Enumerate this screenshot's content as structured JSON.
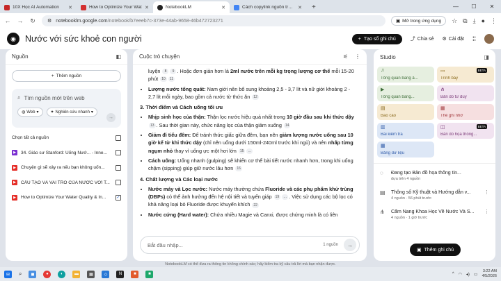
{
  "tabs": [
    {
      "title": "10X Học AI Automation",
      "color": "#c62828"
    },
    {
      "title": "How to Optimize Your Wat",
      "color": "#d32f2f"
    },
    {
      "title": "NotebookLM",
      "color": "#222"
    },
    {
      "title": "Cách copylink nguồn trong not",
      "color": "#4285f4"
    }
  ],
  "address": {
    "domain": "notebooklm.google.com",
    "path": "/notebook/b7eeeb7c-373e-44ab-9658-46b472723271",
    "open_in_app": "Mở trong ứng dụng"
  },
  "app": {
    "title": "Nước với sức khoẻ con người",
    "create_note": "Tạo sổ ghi chú",
    "share": "Chia sẻ",
    "settings": "Cài đặt"
  },
  "sources": {
    "header": "Nguồn",
    "add": "Thêm nguồn",
    "search_placeholder": "Tìm nguồn mới trên web",
    "chip_web": "Web",
    "chip_research": "Nghiên cứu nhanh",
    "select_all": "Chọn tất cả nguồn",
    "items": [
      {
        "title": "34. Giáo sư Stanford: Uống Nướ... - Inne...",
        "icon": "youtube",
        "checked": false
      },
      {
        "title": "Chuyện gì sẽ xảy ra nếu bạn không uốn...",
        "icon": "youtube",
        "checked": false
      },
      {
        "title": "CẤU TẠO VÀ VAI TRÒ CỦA NƯỚC VỚI T...",
        "icon": "youtube",
        "checked": false
      },
      {
        "title": "How to Optimize Your Water Quality & In...",
        "icon": "youtube",
        "checked": true
      }
    ]
  },
  "chat": {
    "header": "Cuộc trò chuyện",
    "l1a": "luyện",
    "l1b": ". Hoặc đơn giản hơn là",
    "l1c": "2ml nước trên mỗi kg trọng lượng cơ thể",
    "l1d": "mỗi 15-20 phút",
    "l2a": "Lượng nước tổng quát:",
    "l2b": "Nam giới nên bổ sung khoảng 2,5 - 3,7 lít và nữ giới khoảng 2 - 2,7 lít mỗi ngày, bao gồm cả nước từ thức ăn",
    "h3": "3. Thời điểm và Cách uống tối ưu",
    "m1a": "Nhịp sinh học của thận:",
    "m1b": "Thận lọc nước hiệu quả nhất trong",
    "m1c": "10 giờ đầu sau khi thức dậy",
    "m1d": ". Sau thời gian này, chức năng lọc của thận giảm xuống",
    "m2a": "Giảm đi tiểu đêm:",
    "m2b": "Để tránh thức giấc giữa đêm, bạn nên",
    "m2c": "giảm lượng nước uống sau 10 giờ kể từ khi thức dậy",
    "m2d": "(chỉ nên uống dưới 150ml-240ml trước khi ngủ) và nên",
    "m2e": "nhấp từng ngụm nhỏ",
    "m2f": "thay vì uống ực một hơi lớn",
    "m3a": "Cách uống:",
    "m3b": "Uống nhanh (gulping) sẽ khiến cơ thể bài tiết nước nhanh hơn, trong khi uống chậm (sipping) giúp giữ nước lâu hơn",
    "h4": "4. Chất lượng và Các loại nước",
    "q1a": "Nước máy và Lọc nước:",
    "q1b": "Nước máy thường chứa",
    "q1c": "Fluoride và các phụ phẩm khử trùng (DBPs)",
    "q1d": "có thể ảnh hưởng đến hệ nội tiết và tuyến giáp",
    "q1e": ". Việc sử dụng các bộ lọc có khả năng loại bỏ Fluoride được khuyến khích",
    "q2a": "Nước cứng (Hard water):",
    "q2b": "Chứa nhiều Magie và Canxi, được chứng minh là có liên",
    "c": {
      "a": "8",
      "b": "9",
      "c": "10",
      "d": "11",
      "e": "12",
      "f": "13",
      "g": "14",
      "h": "15",
      "i": "…",
      "j": "16",
      "k": "19",
      "l": "…",
      "m": "22"
    },
    "input_placeholder": "Bắt đầu nhập...",
    "source_count": "1 nguồn"
  },
  "studio": {
    "header": "Studio",
    "cards": [
      {
        "label": "Tổng quan bằng â...",
        "icon": "audio-icon",
        "bg": "#e6efe0",
        "fg": "#3f6f3a"
      },
      {
        "label": "Trình bày",
        "icon": "slides-icon",
        "bg": "#f6ead2",
        "fg": "#8a6a1c",
        "beta": "BETA"
      },
      {
        "label": "Tổng quan bằng...",
        "icon": "video-icon",
        "bg": "#e6efe0",
        "fg": "#3f6f3a"
      },
      {
        "label": "Bản đồ tư duy",
        "icon": "mindmap-icon",
        "bg": "#f1e3f0",
        "fg": "#7b3b78"
      },
      {
        "label": "Báo cáo",
        "icon": "report-icon",
        "bg": "#f6ead2",
        "fg": "#8a6a1c"
      },
      {
        "label": "Thẻ ghi nhớ",
        "icon": "flashcard-icon",
        "bg": "#f6dfe0",
        "fg": "#a33a3f"
      },
      {
        "label": "Bài kiểm tra",
        "icon": "quiz-icon",
        "bg": "#dde7f6",
        "fg": "#2e5aa8"
      },
      {
        "label": "Bản đồ họa thông...",
        "icon": "infographic-icon",
        "bg": "#f1e3f0",
        "fg": "#7b3b78",
        "beta": "BETA"
      },
      {
        "label": "Bảng dữ liệu",
        "icon": "table-icon",
        "bg": "#dde7f6",
        "fg": "#2e5aa8"
      }
    ],
    "notes": [
      {
        "title": "Đang tạo Bản đồ họa thông tin...",
        "sub": "dựa trên 4 nguồn",
        "icon": "loading-icon"
      },
      {
        "title": "Thông số Kỹ thuật và Hướng dẫn v...",
        "sub": "4 nguồn · 56 phút trước",
        "icon": "doc-icon"
      },
      {
        "title": "Cẩm Nang Khoa Học Về Nước Và S...",
        "sub": "4 nguồn · 1 giờ trước",
        "icon": "mindmap-icon"
      }
    ],
    "add_note": "Thêm ghi chú"
  },
  "footer": "NotebookLM có thể đưa ra thông tin không chính xác; hãy kiểm tra kỹ câu trả lời mà bạn nhận được.",
  "clock": {
    "time": "3:22 AM",
    "date": "4/5/2026"
  }
}
